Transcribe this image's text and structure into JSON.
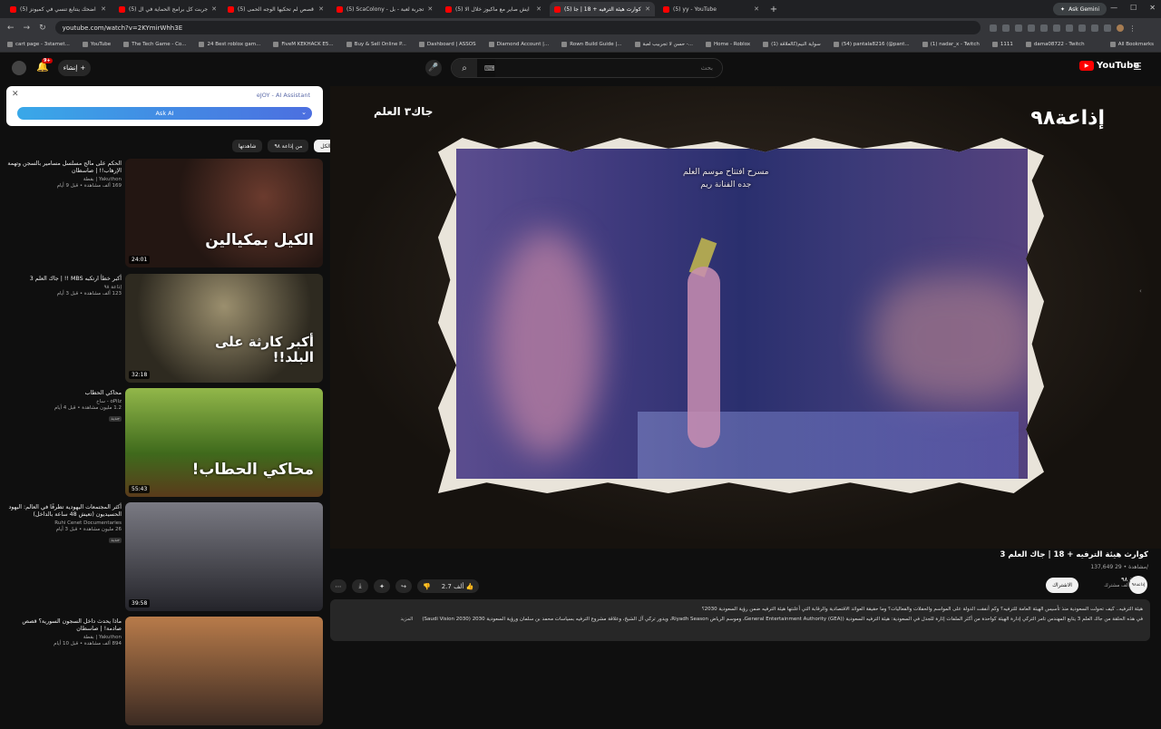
{
  "tabs": [
    {
      "title": "(5) اضحك ينتابع تنسي في كميونز",
      "active": false
    },
    {
      "title": "(5) جربت كل برامج الحماية في ال",
      "active": false
    },
    {
      "title": "(5) قصص لم تحكيها الوجه الحمى",
      "active": false
    },
    {
      "title": "(5) ScaColony - تجربة لعبة - بل",
      "active": false
    },
    {
      "title": "(5) ايش صاير مع ماكيوز خلال الا",
      "active": false
    },
    {
      "title": "(5) كوارث هيئة الترفيه + 18 | جا",
      "active": true
    },
    {
      "title": "(5) yy - YouTube",
      "active": false
    }
  ],
  "gemini": "Ask Gemini",
  "url": "youtube.com/watch?v=2KYmirWhh3E",
  "bookmarks": [
    "cart page - 3stamet...",
    "YouTube",
    "The Tech Game - Co...",
    "24 Best roblox gam...",
    "FiveM KEKHACK E5...",
    "Buy & Sell Online P...",
    "Dashboard | ASSOS",
    "Diamond Account |...",
    "Rown Build Guide |...",
    "حسن لا تجربيب لعبة -...",
    "Home - Roblox",
    "(1) سواية النيم(كالعلاقة",
    "(54) pantala8216 (@pant...",
    "(1) nadar_x - Twitch",
    "1111",
    "dama08722 - Twitch"
  ],
  "all_bookmarks": "All Bookmarks",
  "header": {
    "notif_count": "9+",
    "create_label": "إنشاء",
    "search_placeholder": "بحث",
    "logo": "YouTube",
    "keyboard": "⌨"
  },
  "ai_panel": {
    "brand": "eJOY - AI Assistant",
    "button": "Ask AI"
  },
  "chips": [
    "الكل",
    "من إذاعة ٩٨",
    "شاهدتها"
  ],
  "recs": [
    {
      "title": "الحكم على مالح مسلسل مسامير بالسجن وتهمة الإرهاب!! | صاسطان",
      "channel": "Yakuthon | بقطة",
      "stats": "169 ألف مشاهدة • قبل 9 أيام",
      "duration": "24:01",
      "thumb_text": "الكيل بمكيالين",
      "badge": ""
    },
    {
      "title": "أكبر خطأ ارتكبه MBS !! | جاك العلم 3",
      "channel": "إذاعة ٩٨",
      "stats": "123 ألف مشاهدة • قبل 3 أيام",
      "duration": "32:18",
      "thumb_text": "أكبر كارثة على البلد!!",
      "badge": ""
    },
    {
      "title": "محاكي الحطاب",
      "channel": "oPilz - ساخ",
      "stats": "1.2 مليون مشاهدة • قبل 4 أيام",
      "duration": "55:43",
      "thumb_text": "محاكي الحطاب!",
      "badge": "جديد"
    },
    {
      "title": "أكثر المجتمعات اليهودية تطرفًا في العالم: اليهود الحسيديون (تعيش 48 ساعة بالداخل)",
      "channel": "Ruhi Cenet Documentaries",
      "stats": "26 مليون مشاهدة • قبل 3 أيام",
      "duration": "39:58",
      "thumb_text": "",
      "badge": "جديد"
    },
    {
      "title": "ماذا يحدث داخل السجون السورية؟ قصص صادمة! | صاسطان",
      "channel": "Yakuthon | بقطة",
      "stats": "894 ألف مشاهدة • قبل 10 أيام",
      "duration": "",
      "thumb_text": "",
      "badge": ""
    }
  ],
  "player": {
    "caption": "مسرح افتتاح موسم العلم\nجده الفنانة ريم",
    "logo_right": "إذاعة٩٨",
    "logo_left": "جاك٣ العلم"
  },
  "video": {
    "title": "كوارث هيئة الترفيه + 18 | جاك العلم 3",
    "views": "137,649 مشاهدة • 29/",
    "like_count": "2.7 ألف",
    "channel_name": "إذاعة ٩٨",
    "subscribers": "73.2 ألف مشترك",
    "subscribe": "الاشتراك",
    "avatar_text": "إذاعة٩٨",
    "description_1": "هيئة الترفيه.. كيف تحولت السعودية منذ تأسيس الهيئة العامة للترفيه؟ وكم أنفقت الدولة على المواسم والحفلات والفعاليات؟ وما حقيقة العوائد الاقتصادية والرقابة التي أعلنتها هيئة الترفيه ضمن رؤية السعودية 2030؟",
    "description_2": "في هذه الحلقة من جاك العلم 3 يتابع المهندس تامر التركي إدارة الهيئة كواحدة من أكثر الملفات إثارة للجدل في السعودية: هيئة الترفيه السعودية (General Entertainment Authority (GEA)، وموسم الرياض Riyadh Season، ويدور تركي آل الشيخ، وعلاقة مشروع الترفيه بسياسات محمد بن سلمان ورؤية السعودية 2030 (Saudi Vision 2030)",
    "more": "المزيد"
  }
}
